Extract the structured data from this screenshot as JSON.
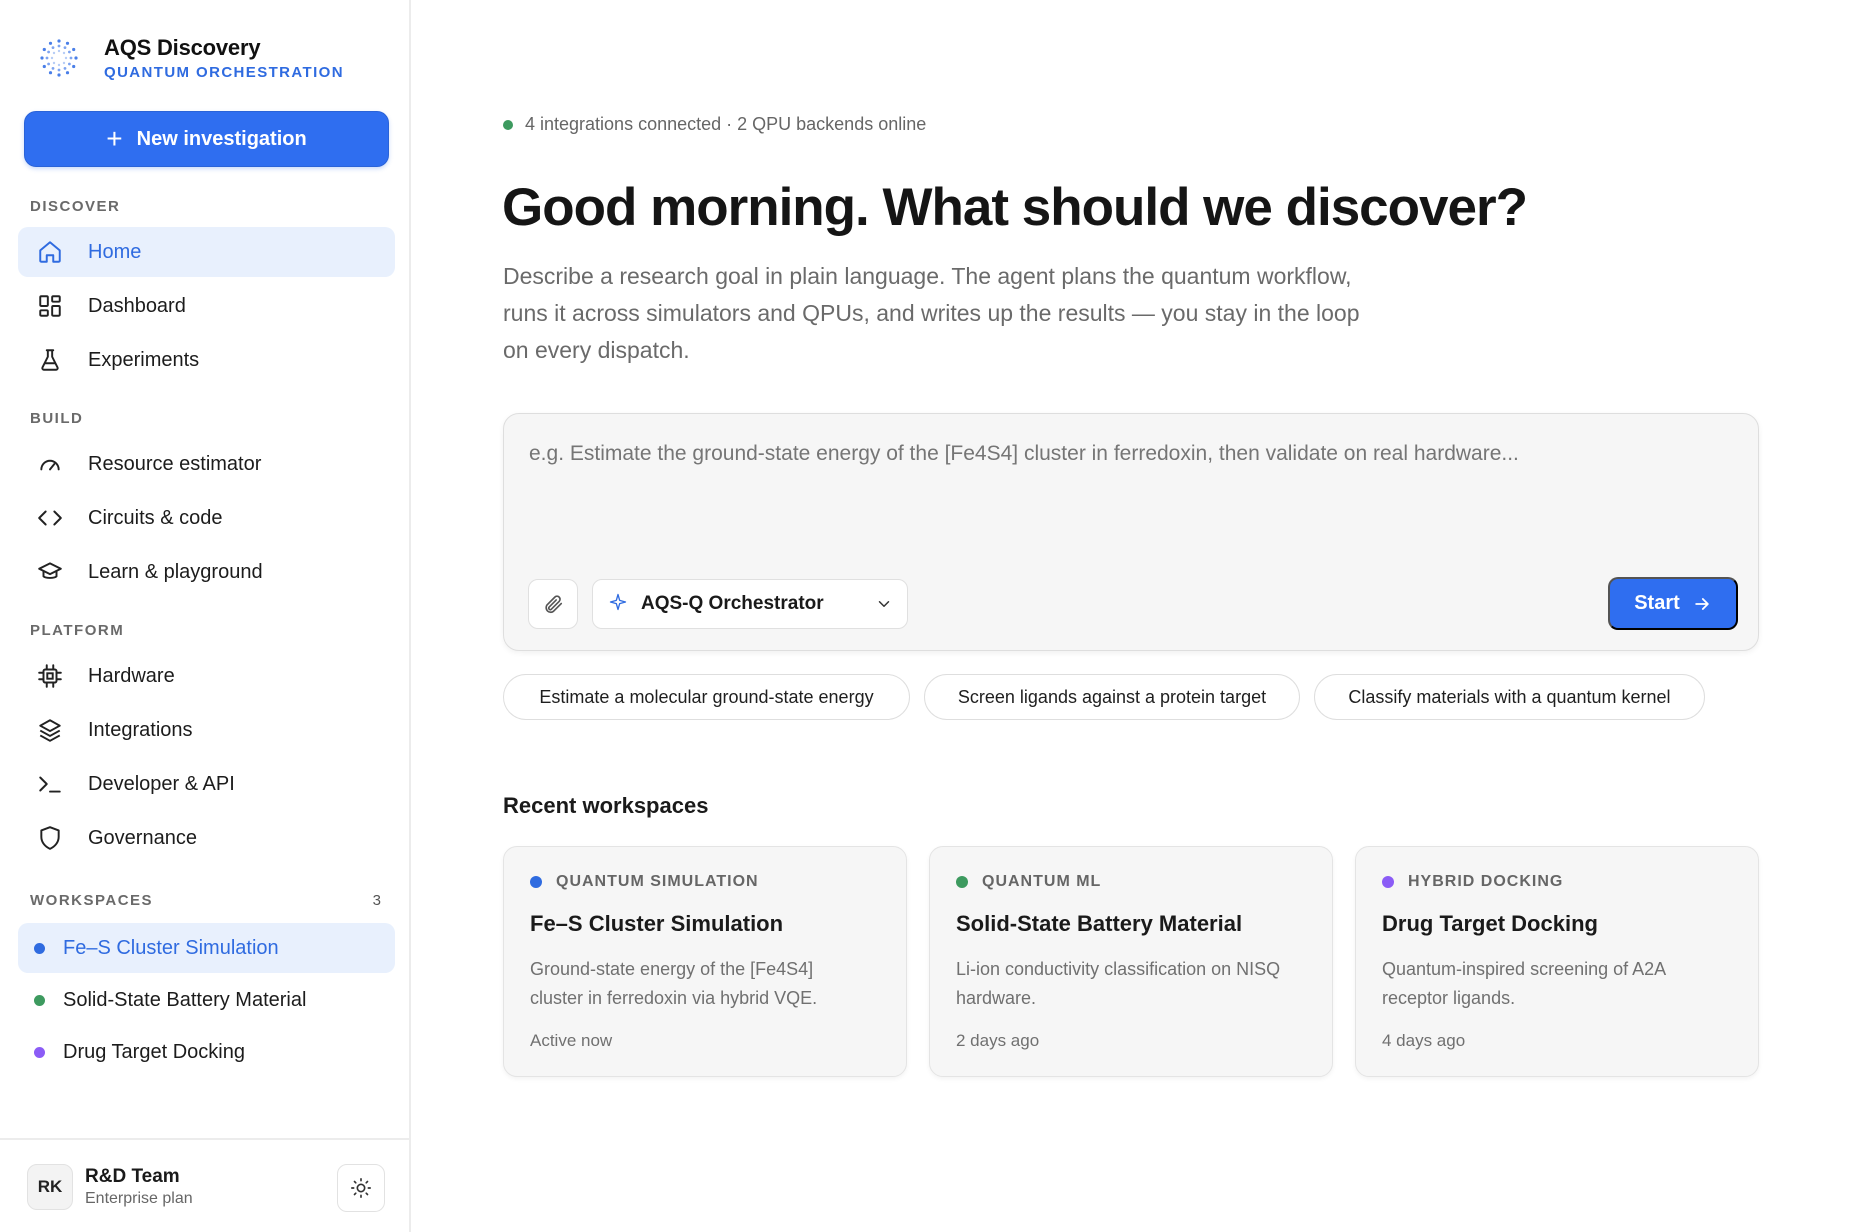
{
  "brand": {
    "name": "AQS Discovery",
    "subtitle": "QUANTUM ORCHESTRATION"
  },
  "sidebar": {
    "new_button": "New investigation",
    "sections": {
      "discover": "DISCOVER",
      "build": "BUILD",
      "platform": "PLATFORM",
      "workspaces": "WORKSPACES"
    },
    "discover_items": [
      {
        "label": "Home",
        "icon": "home-icon",
        "active": true
      },
      {
        "label": "Dashboard",
        "icon": "dashboard-icon"
      },
      {
        "label": "Experiments",
        "icon": "flask-icon"
      }
    ],
    "build_items": [
      {
        "label": "Resource estimator",
        "icon": "gauge-icon"
      },
      {
        "label": "Circuits & code",
        "icon": "code-icon"
      },
      {
        "label": "Learn & playground",
        "icon": "graduation-cap-icon"
      }
    ],
    "platform_items": [
      {
        "label": "Hardware",
        "icon": "chip-icon"
      },
      {
        "label": "Integrations",
        "icon": "layers-icon"
      },
      {
        "label": "Developer & API",
        "icon": "terminal-icon"
      },
      {
        "label": "Governance",
        "icon": "shield-icon"
      }
    ],
    "workspace_count": "3",
    "workspaces": [
      {
        "label": "Fe–S Cluster Simulation",
        "color": "#2f6be0",
        "active": true
      },
      {
        "label": "Solid-State Battery Material",
        "color": "#3d9a5f"
      },
      {
        "label": "Drug Target Docking",
        "color": "#8b5cf6"
      }
    ],
    "footer": {
      "initials": "RK",
      "team": "R&D Team",
      "plan": "Enterprise plan"
    }
  },
  "main": {
    "status": "4 integrations connected · 2 QPU backends online",
    "headline": "Good morning. What should we discover?",
    "description": "Describe a research goal in plain language. The agent plans the quantum workflow, runs it across simulators and QPUs, and writes up the results — you stay in the loop on every dispatch.",
    "composer": {
      "placeholder": "e.g. Estimate the ground-state energy of the [Fe4S4] cluster in ferredoxin, then validate on real hardware...",
      "model": "AQS-Q Orchestrator",
      "start": "Start"
    },
    "suggestions": [
      "Estimate a molecular ground-state energy",
      "Screen ligands against a protein target",
      "Classify materials with a quantum kernel"
    ],
    "recent_title": "Recent workspaces",
    "cards": [
      {
        "tag": "QUANTUM SIMULATION",
        "color": "#2f6be0",
        "title": "Fe–S Cluster Simulation",
        "desc": "Ground-state energy of the [Fe4S4] cluster in ferredoxin via hybrid VQE.",
        "time": "Active now"
      },
      {
        "tag": "QUANTUM ML",
        "color": "#3d9a5f",
        "title": "Solid-State Battery Material",
        "desc": "Li-ion conductivity classification on NISQ hardware.",
        "time": "2 days ago"
      },
      {
        "tag": "HYBRID DOCKING",
        "color": "#8b5cf6",
        "title": "Drug Target Docking",
        "desc": "Quantum-inspired screening of A2A receptor ligands.",
        "time": "4 days ago"
      }
    ]
  }
}
